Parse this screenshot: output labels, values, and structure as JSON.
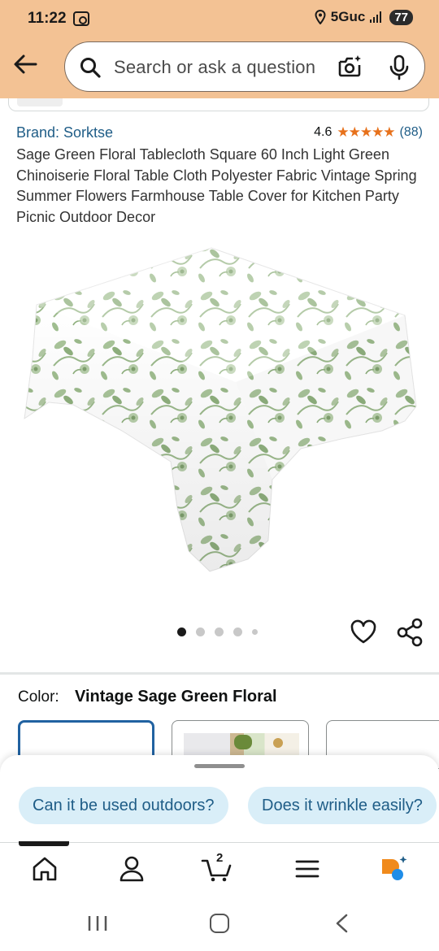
{
  "status_bar": {
    "time": "11:22",
    "network": "5Guc",
    "battery": "77"
  },
  "search": {
    "placeholder": "Search or ask a question"
  },
  "icons": {
    "back": "back-arrow-icon",
    "search": "search-icon",
    "lens": "camera-lens-icon",
    "mic": "microphone-icon",
    "heart": "heart-icon",
    "share": "share-icon",
    "home": "home-icon",
    "account": "account-icon",
    "cart": "cart-icon",
    "menu": "menu-icon",
    "rufus": "rufus-assistant-icon"
  },
  "product": {
    "brand": "Brand: Sorktse",
    "rating": "4.6",
    "stars": "★★★★★",
    "review_count": "(88)",
    "title": "Sage Green Floral Tablecloth Square 60 Inch Light Green Chinoiserie Floral Table Cloth Polyester Fabric Vintage Spring Summer Flowers Farmhouse Table Cover for Kitchen Party Picnic Outdoor Decor",
    "carousel_dots": 5,
    "carousel_active_index": 0
  },
  "color": {
    "label": "Color:",
    "value": "Vintage Sage Green Floral"
  },
  "questions": {
    "chips": [
      "Can it be used outdoors?",
      "Does it wrinkle easily?"
    ]
  },
  "nav": {
    "cart_count": "2"
  },
  "colors": {
    "header_bg": "#f3c294",
    "link_blue": "#1f5d87",
    "star_orange": "#e7711b",
    "chip_bg": "#d9eef8",
    "selected_border": "#2162a1",
    "floral_green": "#8fb07e"
  }
}
